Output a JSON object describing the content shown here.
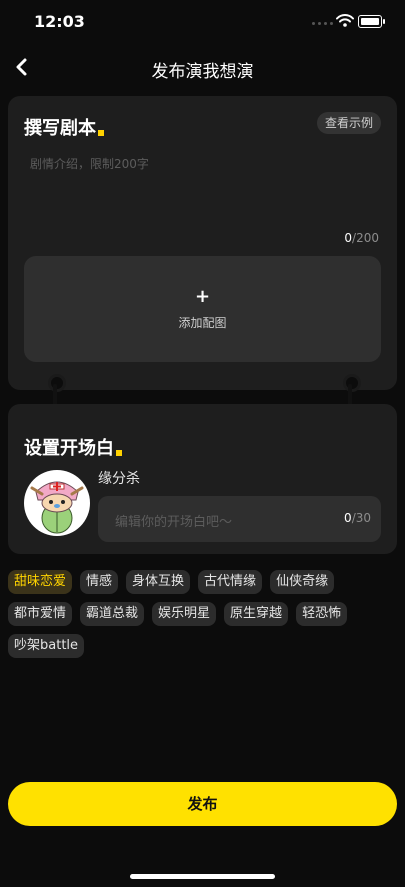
{
  "status": {
    "time": "12:03"
  },
  "nav": {
    "title": "发布演我想演"
  },
  "script_card": {
    "title": "撰写剧本",
    "example_button": "查看示例",
    "placeholder": "剧情介绍，限制200字",
    "count_current": "0",
    "count_max": "/200",
    "add_image_plus": "+",
    "add_image_label": "添加配图"
  },
  "opening_card": {
    "title": "设置开场白",
    "character_name": "缘分杀",
    "placeholder": "编辑你的开场白吧～",
    "count_current": "0",
    "count_max": "/30"
  },
  "tags": [
    {
      "label": "甜味恋爱",
      "selected": true
    },
    {
      "label": "情感",
      "selected": false
    },
    {
      "label": "身体互换",
      "selected": false
    },
    {
      "label": "古代情缘",
      "selected": false
    },
    {
      "label": "仙侠奇缘",
      "selected": false
    },
    {
      "label": "都市爱情",
      "selected": false
    },
    {
      "label": "霸道总裁",
      "selected": false
    },
    {
      "label": "娱乐明星",
      "selected": false
    },
    {
      "label": "原生穿越",
      "selected": false
    },
    {
      "label": "轻恐怖",
      "selected": false
    },
    {
      "label": "吵架battle",
      "selected": false
    }
  ],
  "publish_button": "发布",
  "colors": {
    "accent": "#ffe100",
    "background": "#0c0c0c",
    "card": "#1e1e1e"
  }
}
